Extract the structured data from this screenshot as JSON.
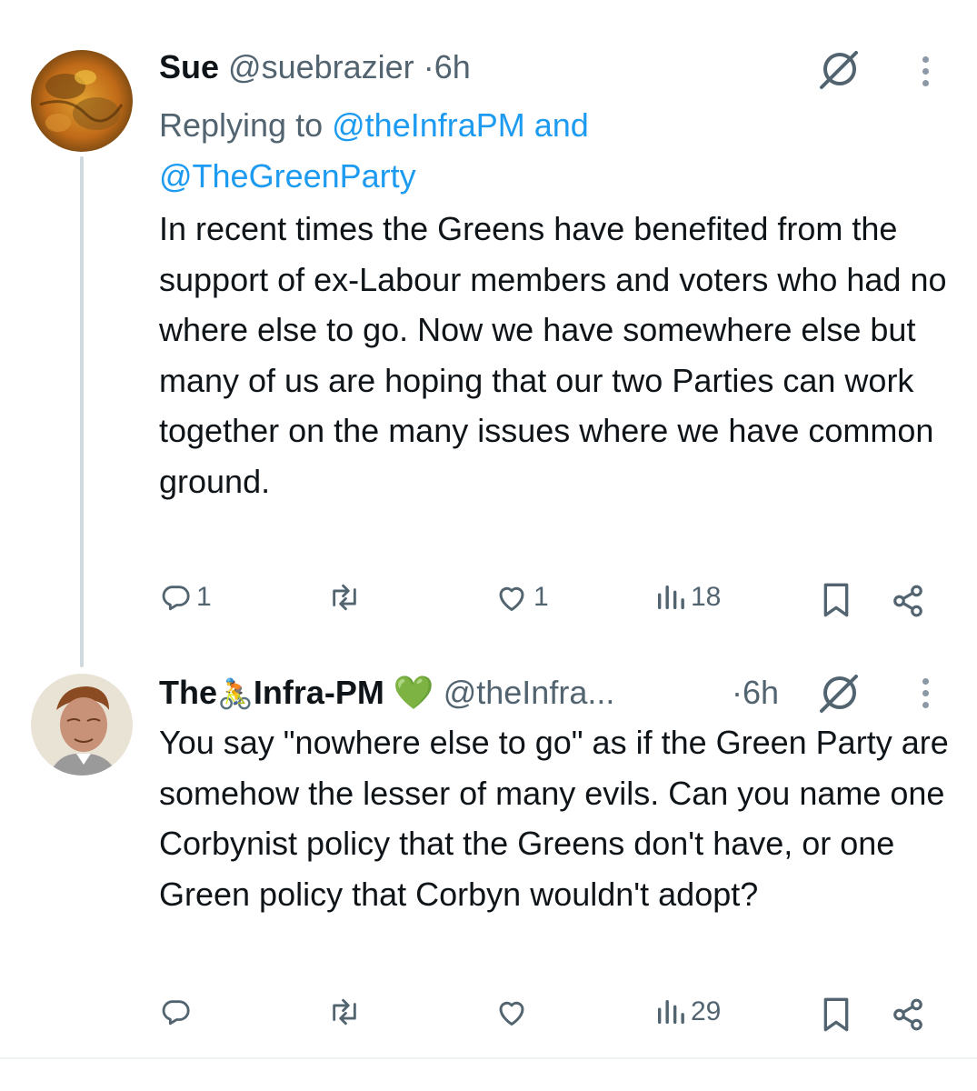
{
  "tweets": [
    {
      "display_name": "Sue",
      "handle": "@suebrazier",
      "sep": "·",
      "time": "6h",
      "replying_prefix": "Replying to",
      "replying_handle1": "@theInfraPM",
      "replying_and": "and",
      "replying_handle2": "@TheGreenParty",
      "text": "In recent times the Greens have benefited from the support of ex-Labour members and voters who had no where else to go. Now we have somewhere else but many of us are hoping that our two Parties can work together on the many issues where we have common ground.",
      "replies": "1",
      "reposts": "",
      "likes": "1",
      "views": "18"
    },
    {
      "display_name_pre": "The",
      "display_name_emoji": "🚴",
      "display_name_post": "Infra-PM",
      "heart_emoji": "💚",
      "handle": "@theInfra...",
      "sep": "·",
      "time": "6h",
      "text": "You say \"nowhere else to go\" as if the Green Party are somehow the lesser of many evils. Can you name one Corbynist policy that the Greens don't have, or one Green policy that Corbyn wouldn't adopt?",
      "replies": "",
      "reposts": "",
      "likes": "",
      "views": "29"
    }
  ],
  "icons": {
    "grok": "grok-slash-circle-icon",
    "more": "more-vertical-icon",
    "reply": "reply-bubble-icon",
    "repost": "repost-arrows-icon",
    "like": "heart-icon",
    "views": "views-bars-icon",
    "bookmark": "bookmark-icon",
    "share": "share-nodes-icon"
  },
  "colors": {
    "text": "#0f1419",
    "muted": "#536471",
    "link": "#1d9bf0",
    "thread_line": "#cfd9de",
    "heart": "#3ba33b"
  }
}
